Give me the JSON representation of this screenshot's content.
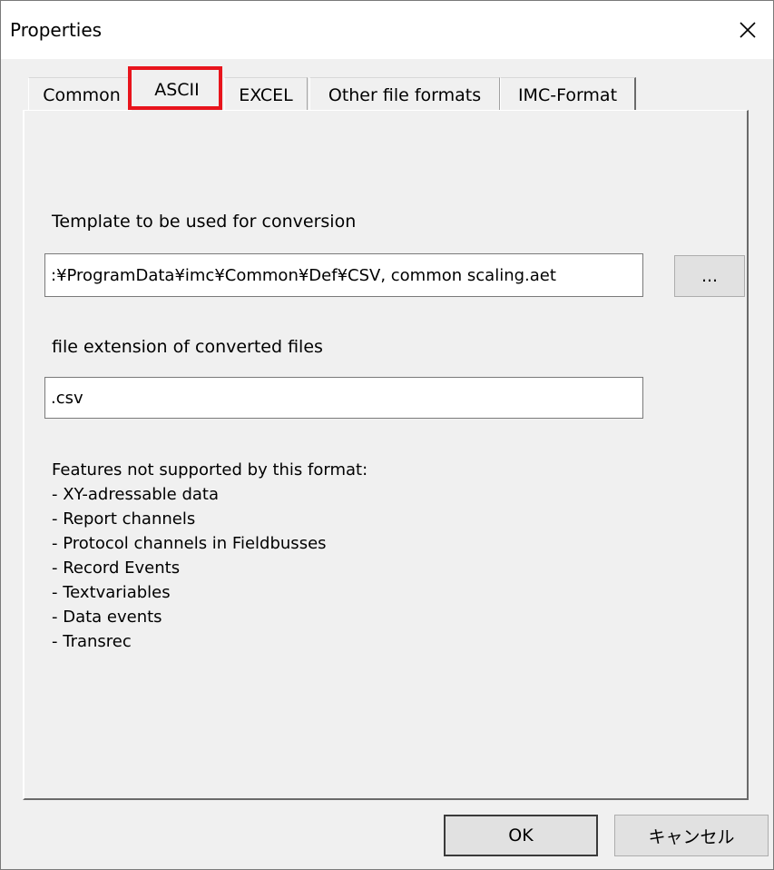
{
  "window": {
    "title": "Properties",
    "close_symbol": "✕"
  },
  "tabs": [
    {
      "label": "Common",
      "selected": false
    },
    {
      "label": "ASCII",
      "selected": true
    },
    {
      "label": "EXCEL",
      "selected": false
    },
    {
      "label": "Other file formats",
      "selected": false
    },
    {
      "label": "IMC-Format",
      "selected": false
    }
  ],
  "ascii": {
    "template_label": "Template to be used for conversion",
    "template_value": ":¥ProgramData¥imc¥Common¥Def¥CSV, common scaling.aet",
    "browse_label": "...",
    "extension_label": "file extension of converted files",
    "extension_value": ".csv",
    "features_heading": "Features not supported by this format:",
    "features": [
      "- XY-adressable data",
      "- Report channels",
      "- Protocol channels in Fieldbusses",
      "- Record Events",
      "- Textvariables",
      "- Data events",
      "- Transrec"
    ]
  },
  "footer": {
    "ok_label": "OK",
    "cancel_label": "キャンセル"
  },
  "colors": {
    "highlight": "#e8141c"
  }
}
